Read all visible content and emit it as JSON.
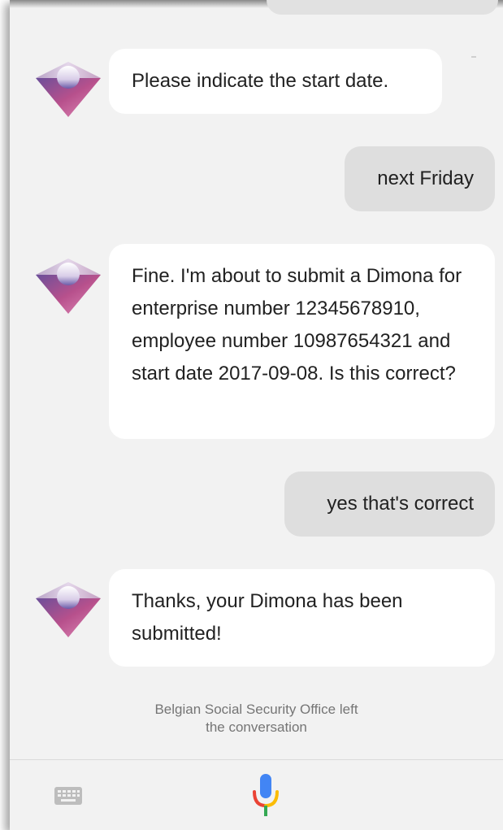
{
  "conversation": {
    "messages": [
      {
        "sender": "assistant",
        "text": "Please indicate the start date."
      },
      {
        "sender": "user",
        "text": "next Friday"
      },
      {
        "sender": "assistant",
        "text": "Fine. I'm about to submit a Dimona for enterprise number 12345678910, employee number 10987654321 and start date 2017-09-08. Is this correct?"
      },
      {
        "sender": "user",
        "text": "yes that's correct"
      },
      {
        "sender": "assistant",
        "text": "Thanks, your Dimona has been submitted!"
      }
    ],
    "status_line_1": "Belgian Social Security Office left",
    "status_line_2": "the conversation"
  },
  "input_bar": {
    "keyboard_icon": "keyboard-icon",
    "mic_icon": "microphone-icon"
  },
  "colors": {
    "background": "#f2f2f2",
    "assistant_bubble": "#ffffff",
    "user_bubble": "#dedede",
    "status_text": "#757575",
    "mic_blue": "#4285f4",
    "mic_red": "#ea4335",
    "mic_yellow": "#fbbc05",
    "mic_green": "#34a853"
  }
}
